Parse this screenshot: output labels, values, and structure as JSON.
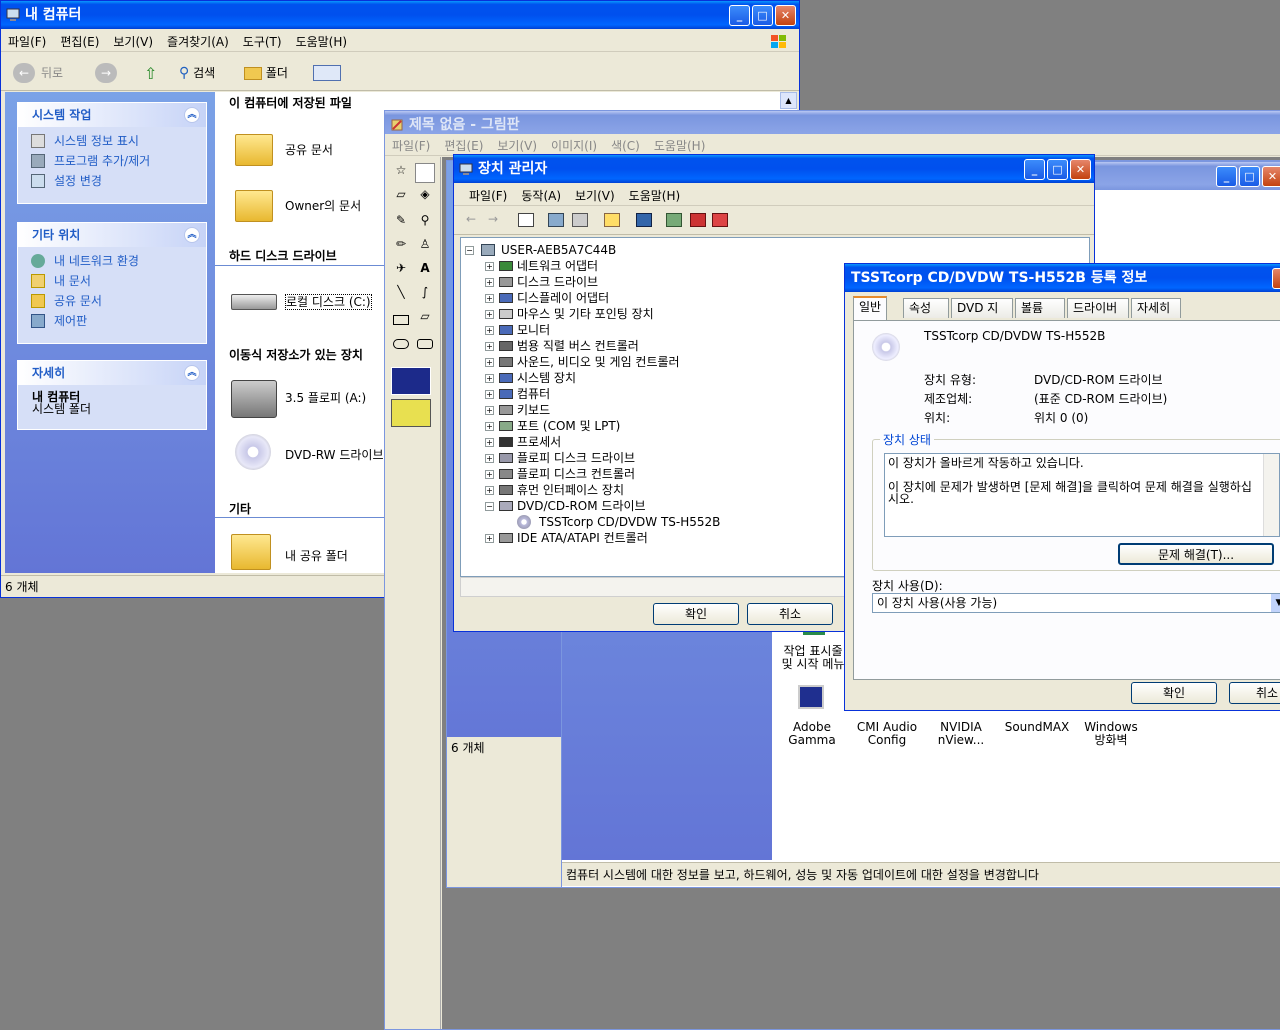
{
  "mycomputer": {
    "title": "내 컴퓨터",
    "menu": [
      "파일(F)",
      "편집(E)",
      "보기(V)",
      "즐겨찾기(A)",
      "도구(T)",
      "도움말(H)"
    ],
    "toolbar": {
      "back": "뒤로",
      "search": "검색",
      "folders": "폴더"
    },
    "system_tasks": {
      "title": "시스템 작업",
      "items": [
        "시스템 정보 표시",
        "프로그램 추가/제거",
        "설정 변경"
      ]
    },
    "other_places": {
      "title": "기타 위치",
      "items": [
        "내 네트워크 환경",
        "내 문서",
        "공유 문서",
        "제어판"
      ]
    },
    "details": {
      "title": "자세히",
      "name": "내 컴퓨터",
      "type": "시스템 폴더"
    },
    "sections": {
      "stored": "이 컴퓨터에 저장된 파일",
      "hdd": "하드 디스크 드라이브",
      "removable": "이동식 저장소가 있는 장치",
      "other": "기타"
    },
    "items": {
      "shared_docs": "공유 문서",
      "owner_docs": "Owner의 문서",
      "local_disk": "로컬 디스크 (C:)",
      "floppy": "3.5 플로피 (A:)",
      "dvd": "DVD-RW 드라이브",
      "my_shared": "내 공유 폴더"
    },
    "status": "6 개체"
  },
  "paint": {
    "title": "제목 없음 - 그림판",
    "menu": [
      "파일(F)",
      "편집(E)",
      "보기(V)",
      "이미지(I)",
      "색(C)",
      "도움말(H)"
    ]
  },
  "devmgr": {
    "title": "장치 관리자",
    "menu": [
      "파일(F)",
      "동작(A)",
      "보기(V)",
      "도움말(H)"
    ],
    "root": "USER-AEB5A7C44B",
    "tree": [
      "네트워크 어댑터",
      "디스크 드라이브",
      "디스플레이 어댑터",
      "마우스 및 기타 포인팅 장치",
      "모니터",
      "범용 직렬 버스 컨트롤러",
      "사운드, 비디오 및 게임 컨트롤러",
      "시스템 장치",
      "컴퓨터",
      "키보드",
      "포트 (COM 및 LPT)",
      "프로세서",
      "플로피 디스크 드라이브",
      "플로피 디스크 컨트롤러",
      "휴먼 인터페이스 장치",
      "DVD/CD-ROM 드라이브"
    ],
    "child": "TSSTcorp CD/DVDW TS-H552B",
    "last": "IDE ATA/ATAPI 컨트롤러",
    "ok": "확인",
    "cancel": "취소",
    "status": "6 개체"
  },
  "props": {
    "title": "TSSTcorp CD/DVDW TS-H552B 등록 정보",
    "tabs": [
      "일반",
      "속성",
      "DVD 지역",
      "볼륨",
      "드라이버",
      "자세히"
    ],
    "device_name": "TSSTcorp CD/DVDW TS-H552B",
    "labels": {
      "type": "장치 유형:",
      "maker": "제조업체:",
      "location": "위치:"
    },
    "values": {
      "type": "DVD/CD-ROM 드라이브",
      "maker": "(표준 CD-ROM 드라이브)",
      "location": "위치 0 (0)"
    },
    "status_group": "장치 상태",
    "status_line1": "이 장치가 올바르게 작동하고 있습니다.",
    "status_line2": "이 장치에 문제가 발생하면 [문제 해결]을 클릭하여 문제 해결을 실행하십시오.",
    "troubleshoot": "문제 해결(T)...",
    "usage_label": "장치 사용(D):",
    "usage_value": "이 장치 사용(사용 가능)",
    "ok": "확인",
    "cancel": "취소"
  },
  "controlpanel": {
    "icons": [
      {
        "line1": "작업 표시줄",
        "line2": "및 시작 메뉴"
      },
      {
        "line1": "Adobe",
        "line2": "Gamma"
      },
      {
        "line1": "CMI Audio",
        "line2": "Config"
      },
      {
        "line1": "NVIDIA",
        "line2": "nView..."
      },
      {
        "line1": "SoundMAX",
        "line2": ""
      },
      {
        "line1": "Windows",
        "line2": "방화벽"
      }
    ],
    "status": "컴퓨터 시스템에 대한 정보를 보고, 하드웨어, 성능 및 자동 업데이트에 대한 설정을 변경합니다"
  }
}
